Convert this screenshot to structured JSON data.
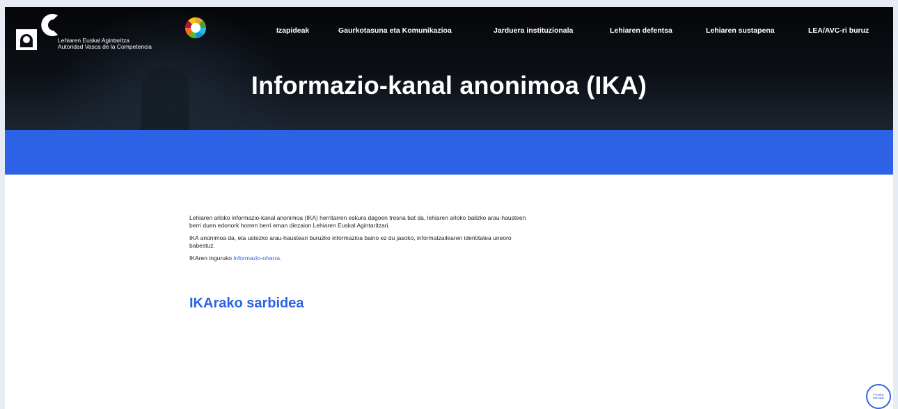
{
  "header": {
    "org_name_eu": "Lehiaren Euskal Agintaritza",
    "org_name_es": "Autoridad Vasca de la Competencia",
    "logo_icon": "lea-avc-logo-icon",
    "sdg_icon": "sdg-wheel-icon"
  },
  "nav": {
    "items": [
      {
        "label": "Izapideak"
      },
      {
        "label": "Gaurkotasuna eta Komunikazioa"
      },
      {
        "label": "Jarduera instituzionala"
      },
      {
        "label": "Lehiaren defentsa"
      },
      {
        "label": "Lehiaren sustapena"
      },
      {
        "label": "LEA/AVC-ri buruz"
      }
    ]
  },
  "hero": {
    "title": "Informazio-kanal anonimoa (IKA)"
  },
  "content": {
    "p1": "Lehiaren arloko informazio-kanal anonimoa (IKA) herritarren eskura dagoen tresna bat da, lehiaren arloko balizko arau-hausteen berri duen edonork horren berri eman diezaion Lehiaren Euskal Agintaritzari.",
    "p2": "IKA anonimoa da, eta ustezko arau-hausteari buruzko informazioa baino ez du jasoko, informatzailearen identitatea uneoro babestuz.",
    "p3_prefix": "IKAren inguruko ",
    "p3_link": "informazio-oharra",
    "p3_suffix": ".",
    "section_heading": "IKArako sarbidea"
  },
  "floating_button": {
    "line1": "Prueba",
    "line2": "PRUEB"
  },
  "colors": {
    "accent": "#2e62e6",
    "hero_dark": "#0b0f15",
    "text": "#222222"
  }
}
